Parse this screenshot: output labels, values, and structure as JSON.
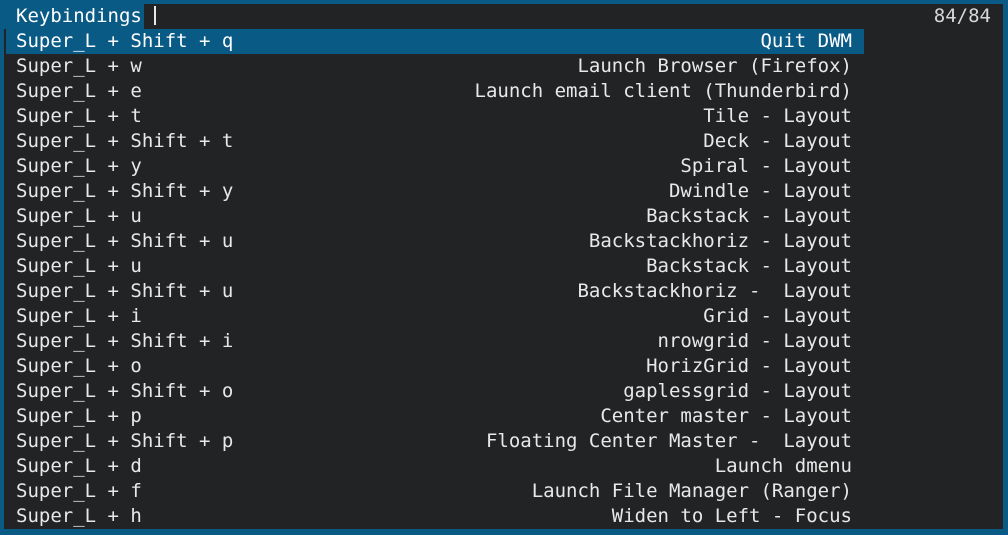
{
  "prompt": {
    "label": "Keybindings",
    "input_value": "",
    "counter": "84/84"
  },
  "items": [
    {
      "key": "Super_L + Shift + q",
      "desc": "Quit DWM",
      "selected": true
    },
    {
      "key": "Super_L + w",
      "desc": "Launch Browser (Firefox)"
    },
    {
      "key": "Super_L + e",
      "desc": "Launch email client (Thunderbird)"
    },
    {
      "key": "Super_L + t",
      "desc": "Tile - Layout"
    },
    {
      "key": "Super_L + Shift + t",
      "desc": "Deck - Layout"
    },
    {
      "key": "Super_L + y",
      "desc": "Spiral - Layout"
    },
    {
      "key": "Super_L + Shift + y",
      "desc": "Dwindle - Layout"
    },
    {
      "key": "Super_L + u",
      "desc": "Backstack - Layout"
    },
    {
      "key": "Super_L + Shift + u",
      "desc": "Backstackhoriz - Layout"
    },
    {
      "key": "Super_L + u",
      "desc": "Backstack - Layout"
    },
    {
      "key": "Super_L + Shift + u",
      "desc": "Backstackhoriz -  Layout"
    },
    {
      "key": "Super_L + i",
      "desc": "Grid - Layout"
    },
    {
      "key": "Super_L + Shift + i",
      "desc": "nrowgrid - Layout"
    },
    {
      "key": "Super_L + o",
      "desc": "HorizGrid - Layout"
    },
    {
      "key": "Super_L + Shift + o",
      "desc": "gaplessgrid - Layout"
    },
    {
      "key": "Super_L + p",
      "desc": "Center master - Layout"
    },
    {
      "key": "Super_L + Shift + p",
      "desc": "Floating Center Master -  Layout"
    },
    {
      "key": "Super_L + d",
      "desc": "Launch dmenu"
    },
    {
      "key": "Super_L + f",
      "desc": "Launch File Manager (Ranger)"
    },
    {
      "key": "Super_L + h",
      "desc": "Widen to Left - Focus"
    }
  ],
  "colors": {
    "accent": "#0a5a86",
    "background": "#222324",
    "text": "#e8e8e8"
  }
}
